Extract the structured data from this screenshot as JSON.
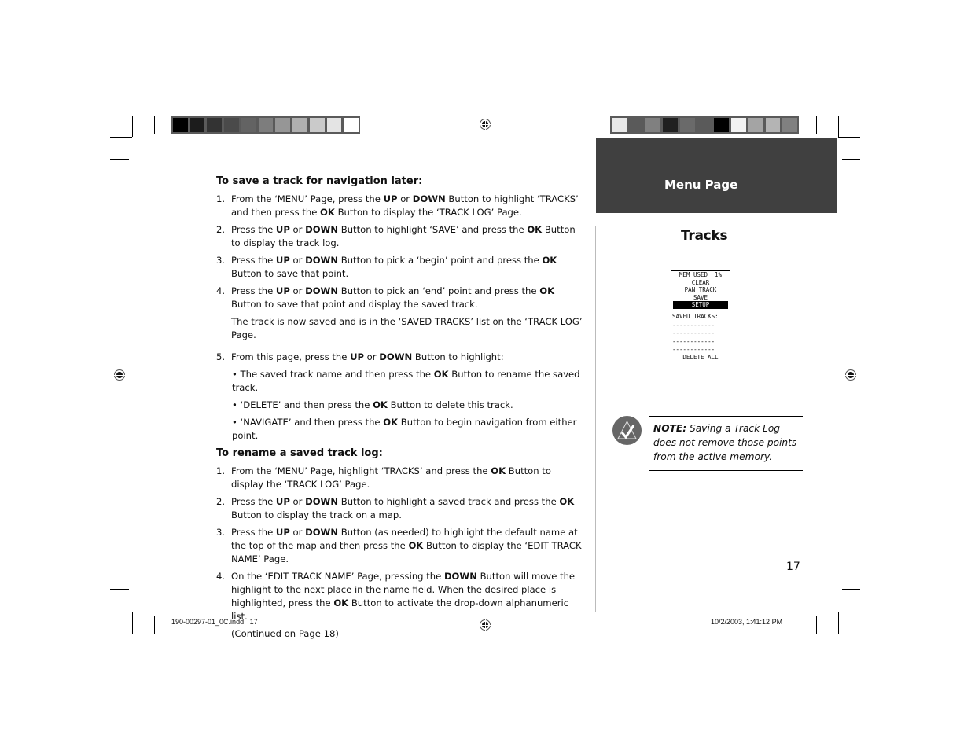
{
  "print_marks": {
    "left_swatches": [
      "#000000",
      "#1c1c1c",
      "#333333",
      "#4a4a4a",
      "#636363",
      "#7d7d7d",
      "#969696",
      "#b0b0b0",
      "#cacaca",
      "#e4e4e4",
      "#ffffff"
    ],
    "right_swatches": [
      "#e8e8e8",
      "#5a5a5a",
      "#808080",
      "#202020",
      "#6a6a6a",
      "#5a5a5a",
      "#000000",
      "#f2f2f2",
      "#a4a4a4",
      "#b4b4b4",
      "#808080"
    ]
  },
  "main": {
    "section1": {
      "heading": "To save a track for navigation later:",
      "steps": [
        {
          "num": "1.",
          "parts": [
            "From the ‘MENU’ Page, press the ",
            "UP",
            " or ",
            "DOWN",
            " Button to highlight ‘TRACKS’ and then press the ",
            "OK",
            " Button to display the ‘TRACK LOG’ Page."
          ]
        },
        {
          "num": "2.",
          "parts": [
            "Press the ",
            "UP",
            " or ",
            "DOWN",
            " Button to highlight ‘SAVE’ and press the ",
            "OK",
            " Button to display the track log."
          ]
        },
        {
          "num": "3.",
          "parts": [
            "Press the ",
            "UP",
            " or ",
            "DOWN",
            " Button to pick a ‘begin’ point and press the ",
            "OK",
            " Button to save that point."
          ]
        },
        {
          "num": "4.",
          "parts": [
            "Press the ",
            "UP",
            " or ",
            "DOWN",
            " Button to pick an ‘end’ point and press the ",
            "OK",
            " Button to save that point and display the saved track."
          ]
        }
      ],
      "after_note": "The track is now saved and is in the ‘SAVED TRACKS’ list on the ‘TRACK LOG’ Page.",
      "step5": {
        "num": "5.",
        "parts": [
          "From this page, press the ",
          "UP",
          " or ",
          "DOWN",
          " Button to highlight:"
        ]
      },
      "bullets": [
        {
          "parts": [
            "• The saved track name and then press the ",
            "OK",
            " Button to rename the saved track."
          ]
        },
        {
          "parts": [
            "• ‘DELETE’ and then press the ",
            "OK",
            " Button to delete this track."
          ]
        },
        {
          "parts": [
            "• ‘NAVIGATE’ and then press the ",
            "OK",
            " Button to begin navigation from either point."
          ]
        }
      ]
    },
    "section2": {
      "heading": "To rename a saved track log:",
      "steps": [
        {
          "num": "1.",
          "parts": [
            "From the ‘MENU’ Page, highlight ‘TRACKS’ and press the ",
            "OK",
            " Button to display the ‘TRACK LOG’ Page."
          ]
        },
        {
          "num": "2.",
          "parts": [
            "Press the ",
            "UP",
            " or ",
            "DOWN",
            " Button to highlight a saved track and press the ",
            "OK",
            " Button to display the track on a map."
          ]
        },
        {
          "num": "3.",
          "parts": [
            "Press the ",
            "UP",
            " or ",
            "DOWN",
            " Button (as needed) to highlight the default name at the top of the map and then press the ",
            "OK",
            " Button to display the ‘EDIT TRACK NAME’ Page."
          ]
        },
        {
          "num": "4.",
          "parts": [
            "On the ‘EDIT TRACK NAME’ Page, pressing the ",
            "DOWN",
            " Button will move the highlight to the next place in the name field. When the desired place is highlighted, press the ",
            "OK",
            " Button to activate the drop-down alphanumeric list."
          ]
        }
      ],
      "continued": "(Continued on Page 18)"
    }
  },
  "sidebar": {
    "title": "Menu Page",
    "section_title": "Tracks",
    "device_screen": {
      "header": "MEM USED  1%",
      "menu": [
        "CLEAR",
        "PAN TRACK",
        "SAVE"
      ],
      "highlighted": "SETUP",
      "saved_label": "SAVED TRACKS:",
      "slots": [
        "------------",
        "------------",
        "------------",
        "------------"
      ],
      "footer": "DELETE ALL"
    },
    "note": {
      "label": "NOTE:",
      "text": " Saving a Track Log does not remove those points from the active memory."
    }
  },
  "page_number": "17",
  "footer": {
    "file": "190-00297-01_0C.indd   17",
    "timestamp": "10/2/2003, 1:41:12 PM"
  }
}
